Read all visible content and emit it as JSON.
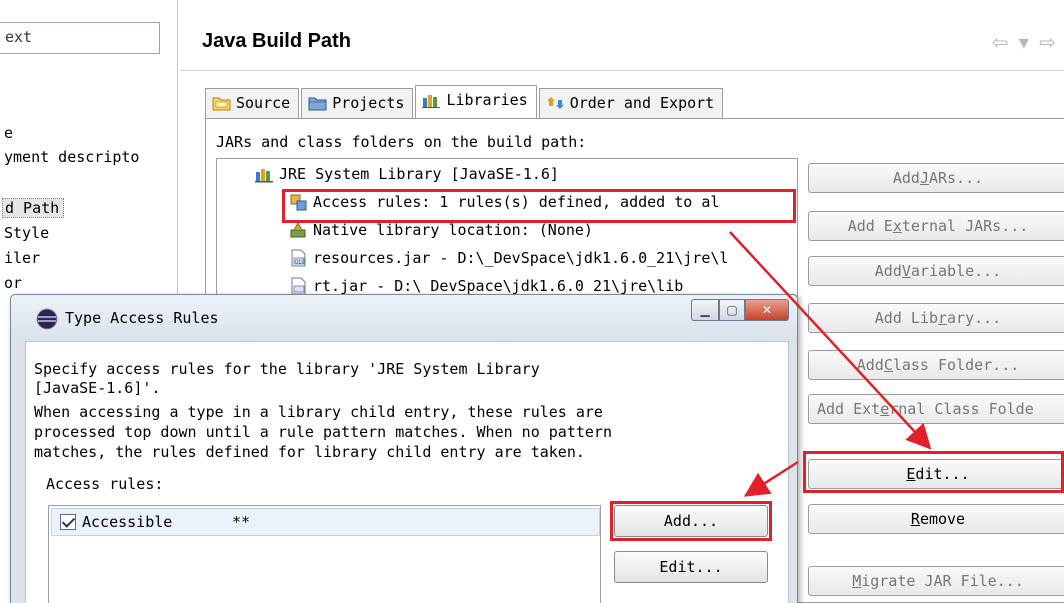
{
  "left_panel": {
    "filter_text": "ext",
    "items": [
      {
        "label": "e"
      },
      {
        "label": "yment descripto"
      },
      {
        "label": "d Path"
      },
      {
        "label": " Style"
      },
      {
        "label": "iler"
      },
      {
        "label": "or"
      }
    ]
  },
  "header": {
    "title": "Java Build Path",
    "nav_arrows": "⇦ ▾ ⇨"
  },
  "tabs": [
    {
      "label": "Source"
    },
    {
      "label": "Projects"
    },
    {
      "label": "Libraries"
    },
    {
      "label": "Order and Export"
    }
  ],
  "libraries": {
    "section_label": "JARs and class folders on the build path:",
    "tree": [
      {
        "label": "JRE System Library [JavaSE-1.6]",
        "icon": "library-icon"
      },
      {
        "label": "Access rules: 1 rules(s) defined, added to al",
        "icon": "access-rules-icon"
      },
      {
        "label": "Native library location: (None)",
        "icon": "native-library-icon"
      },
      {
        "label": "resources.jar - D:\\_DevSpace\\jdk1.6.0_21\\jre\\l",
        "icon": "jar-icon"
      },
      {
        "label": "rt.jar - D:\\_DevSpace\\jdk1.6.0_21\\jre\\lib",
        "icon": "jar-icon"
      }
    ]
  },
  "side_buttons": [
    {
      "pre": "Add ",
      "mn": "J",
      "post": "ARs..."
    },
    {
      "pre": "Add E",
      "mn": "x",
      "post": "ternal JARs..."
    },
    {
      "pre": "Add ",
      "mn": "V",
      "post": "ariable..."
    },
    {
      "pre": "Add Lib",
      "mn": "r",
      "post": "ary..."
    },
    {
      "pre": "Add ",
      "mn": "C",
      "post": "lass Folder..."
    },
    {
      "pre": "Add Ext",
      "mn": "e",
      "post": "rnal Class Folde"
    },
    {
      "pre": "",
      "mn": "E",
      "post": "dit..."
    },
    {
      "pre": "",
      "mn": "R",
      "post": "emove"
    },
    {
      "pre": "",
      "mn": "M",
      "post": "igrate JAR File..."
    }
  ],
  "dialog": {
    "title": "Type Access Rules",
    "desc_line1": "Specify access rules for the library 'JRE System Library",
    "desc_line2": "[JavaSE-1.6]'.",
    "desc_line3": "When accessing a type in a library child entry, these rules are",
    "desc_line4": "processed top down until a rule pattern matches. When no pattern",
    "desc_line5": "matches, the rules defined for library child entry are taken.",
    "rules_label": "Access rules:",
    "rules": [
      {
        "kind": "Accessible",
        "pattern": "**",
        "checked": true
      }
    ],
    "add_button": "Add...",
    "edit_button": "Edit..."
  },
  "colors": {
    "highlight": "#e0202a"
  }
}
